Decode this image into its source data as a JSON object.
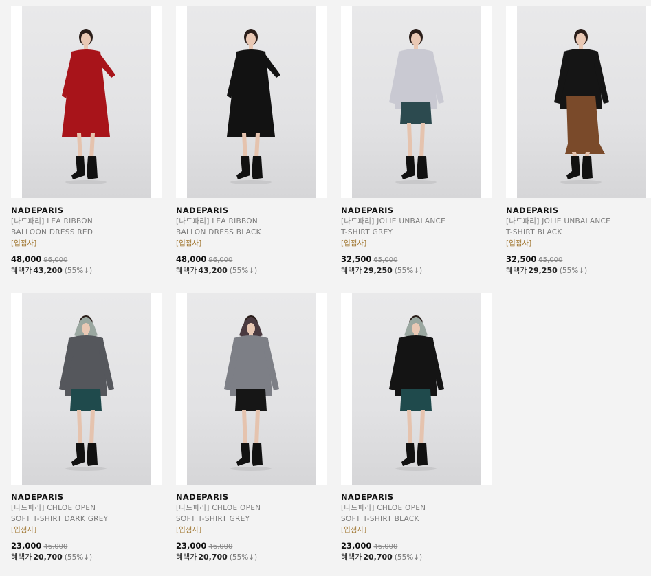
{
  "products": [
    {
      "brand": "NADEPARIS",
      "name_line1": "[나드파리] LEA RIBBON",
      "name_line2": "BALLOON DRESS RED",
      "tag": "[입점사]",
      "price": "48,000",
      "original_price": "96,000",
      "benefit_label": "혜택가",
      "benefit_price": "43,200",
      "discount": "(55%↓)",
      "top_color": "#a8141a",
      "bottom_color": "#a8141a",
      "dress": true,
      "scarf": false,
      "scarf_color": ""
    },
    {
      "brand": "NADEPARIS",
      "name_line1": "[나드파리] LEA RIBBON",
      "name_line2": "BALLON DRESS BLACK",
      "tag": "[입점사]",
      "price": "48,000",
      "original_price": "96,000",
      "benefit_label": "혜택가",
      "benefit_price": "43,200",
      "discount": "(55%↓)",
      "top_color": "#121212",
      "bottom_color": "#121212",
      "dress": true,
      "scarf": false,
      "scarf_color": ""
    },
    {
      "brand": "NADEPARIS",
      "name_line1": "[나드파리] JOLIE UNBALANCE",
      "name_line2": "T-SHIRT GREY",
      "tag": "[입점사]",
      "price": "32,500",
      "original_price": "65,000",
      "benefit_label": "혜택가",
      "benefit_price": "29,250",
      "discount": "(55%↓)",
      "top_color": "#c9c9d2",
      "bottom_color": "#2c4a4f",
      "dress": false,
      "scarf": false,
      "scarf_color": ""
    },
    {
      "brand": "NADEPARIS",
      "name_line1": "[나드파리] JOLIE UNBALANCE",
      "name_line2": "T-SHIRT BLACK",
      "tag": "[입점사]",
      "price": "32,500",
      "original_price": "65,000",
      "benefit_label": "혜택가",
      "benefit_price": "29,250",
      "discount": "(55%↓)",
      "top_color": "#151515",
      "bottom_color": "#7a4a2a",
      "dress": false,
      "scarf": false,
      "scarf_color": "",
      "long_skirt": true
    },
    {
      "brand": "NADEPARIS",
      "name_line1": "[나드파리] CHLOE OPEN",
      "name_line2": "SOFT T-SHIRT DARK GREY",
      "tag": "[입점사]",
      "price": "23,000",
      "original_price": "46,000",
      "benefit_label": "혜택가",
      "benefit_price": "20,700",
      "discount": "(55%↓)",
      "top_color": "#55575c",
      "bottom_color": "#1f4a4c",
      "dress": false,
      "scarf": true,
      "scarf_color": "#9aa7a0"
    },
    {
      "brand": "NADEPARIS",
      "name_line1": "[나드파리] CHLOE OPEN",
      "name_line2": "SOFT T-SHIRT GREY",
      "tag": "[입점사]",
      "price": "23,000",
      "original_price": "46,000",
      "benefit_label": "혜택가",
      "benefit_price": "20,700",
      "discount": "(55%↓)",
      "top_color": "#7d7f86",
      "bottom_color": "#161616",
      "dress": false,
      "scarf": true,
      "scarf_color": "#4a3a40"
    },
    {
      "brand": "NADEPARIS",
      "name_line1": "[나드파리] CHLOE OPEN",
      "name_line2": "SOFT T-SHIRT BLACK",
      "tag": "[입점사]",
      "price": "23,000",
      "original_price": "46,000",
      "benefit_label": "혜택가",
      "benefit_price": "20,700",
      "discount": "(55%↓)",
      "top_color": "#141414",
      "bottom_color": "#1f4a4c",
      "dress": false,
      "scarf": true,
      "scarf_color": "#9aa7a0"
    }
  ]
}
